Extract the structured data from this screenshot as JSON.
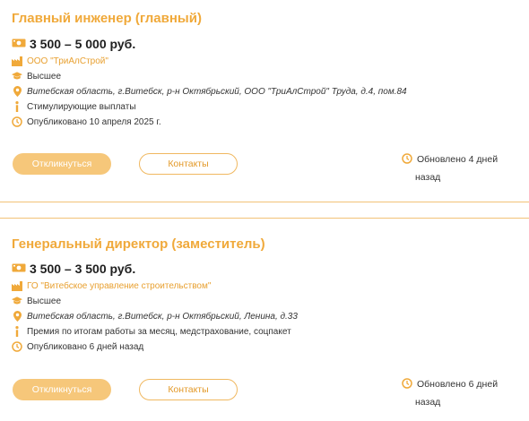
{
  "vacancies": [
    {
      "title": "Главный инженер (главный)",
      "salary": "3 500 – 5 000 руб.",
      "company": "ООО \"ТриАлСтрой\"",
      "education": "Высшее",
      "address": "Витебская область, г.Витебск, р-н Октябрьский, ООО \"ТриАлСтрой\" Труда, д.4, пом.84",
      "benefits": "Стимулирующие выплаты",
      "published": "Опубликовано 10 апреля 2025 г.",
      "respond_label": "Откликнуться",
      "contacts_label": "Контакты",
      "updated_line1": "Обновлено 4 дней",
      "updated_line2": "назад"
    },
    {
      "title": "Генеральный директор (заместитель)",
      "salary": "3 500 – 3 500 руб.",
      "company": "ГО \"Витебское управление строительством\"",
      "education": "Высшее",
      "address": "Витебская область, г.Витебск, р-н Октябрьский, Ленина, д.33",
      "benefits": "Премия по итогам работы за месяц, медстрахование, соцпакет",
      "published": "Опубликовано 6 дней назад",
      "respond_label": "Откликнуться",
      "contacts_label": "Контакты",
      "updated_line1": "Обновлено 6 дней",
      "updated_line2": "назад"
    }
  ],
  "colors": {
    "accent": "#f0a93a",
    "button_fill": "#f6c77a",
    "separator": "#f2c277"
  }
}
